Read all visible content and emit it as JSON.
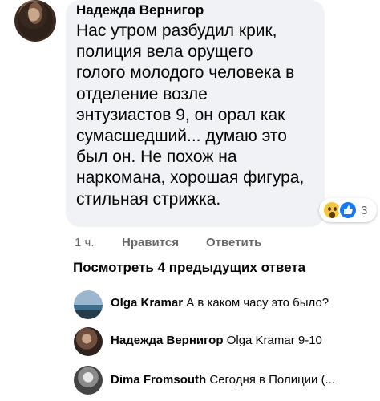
{
  "main_comment": {
    "author": "Надежда Вернигор",
    "text": "Нас утром разбудил крик,\nполиция вела орущего\nголого молодого человека в\nотделение возле\nэнтузиастов 9, он орал как\nсумасшедший... думаю это\nбыл он. Не похож на\nнаркомана, хорошая фигура,\nстильная стрижка.",
    "reaction_count": "3",
    "reaction_icons": [
      "wow-icon",
      "like-icon"
    ],
    "time": "1 ч.",
    "like_label": "Нравится",
    "reply_label": "Ответить"
  },
  "view_more_label": "Посмотреть 4 предыдущих ответа",
  "replies": [
    {
      "author": "Olga Kramar",
      "text": "А в каком часу это было?"
    },
    {
      "author": "Надежда Вернигор",
      "text": "Olga Kramar  9-10"
    },
    {
      "author": "Dima Fromsouth",
      "text": "Сегодня в Полиции (..."
    }
  ],
  "colors": {
    "bubble": "#f0f2f5",
    "secondary_text": "#65676b",
    "like_blue": "#1877f2",
    "wow_yellow": "#f7c740"
  }
}
